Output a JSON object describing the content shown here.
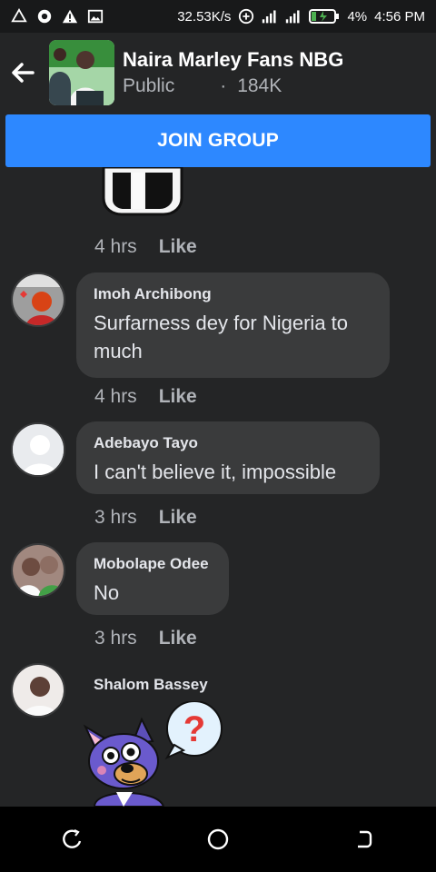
{
  "status_bar": {
    "speed": "32.53K/s",
    "battery": "4%",
    "time": "4:56 PM"
  },
  "group": {
    "name": "Naira Marley Fans NBG",
    "privacy": "Public",
    "separator": "·",
    "members": "184K"
  },
  "join_label": "JOIN GROUP",
  "comments": [
    {
      "time": "4 hrs",
      "like": "Like"
    },
    {
      "author": "Imoh Archibong",
      "text_line1": "Surfarness dey for Nigeria to",
      "text_line2": "much",
      "time": "4 hrs",
      "like": "Like"
    },
    {
      "author": "Adebayo Tayo",
      "text": "I can't believe it, impossible",
      "time": "3 hrs",
      "like": "Like"
    },
    {
      "author": "Mobolape Odee",
      "text": "No",
      "time": "3 hrs",
      "like": "Like"
    },
    {
      "author": "Shalom Bassey"
    }
  ],
  "icons": {
    "back": "arrow-left-icon",
    "nav_back": "back-icon",
    "nav_home": "home-icon",
    "nav_recents": "recents-icon"
  },
  "colors": {
    "accent": "#2d88ff",
    "background": "#242526",
    "bubble": "#3a3b3c"
  }
}
